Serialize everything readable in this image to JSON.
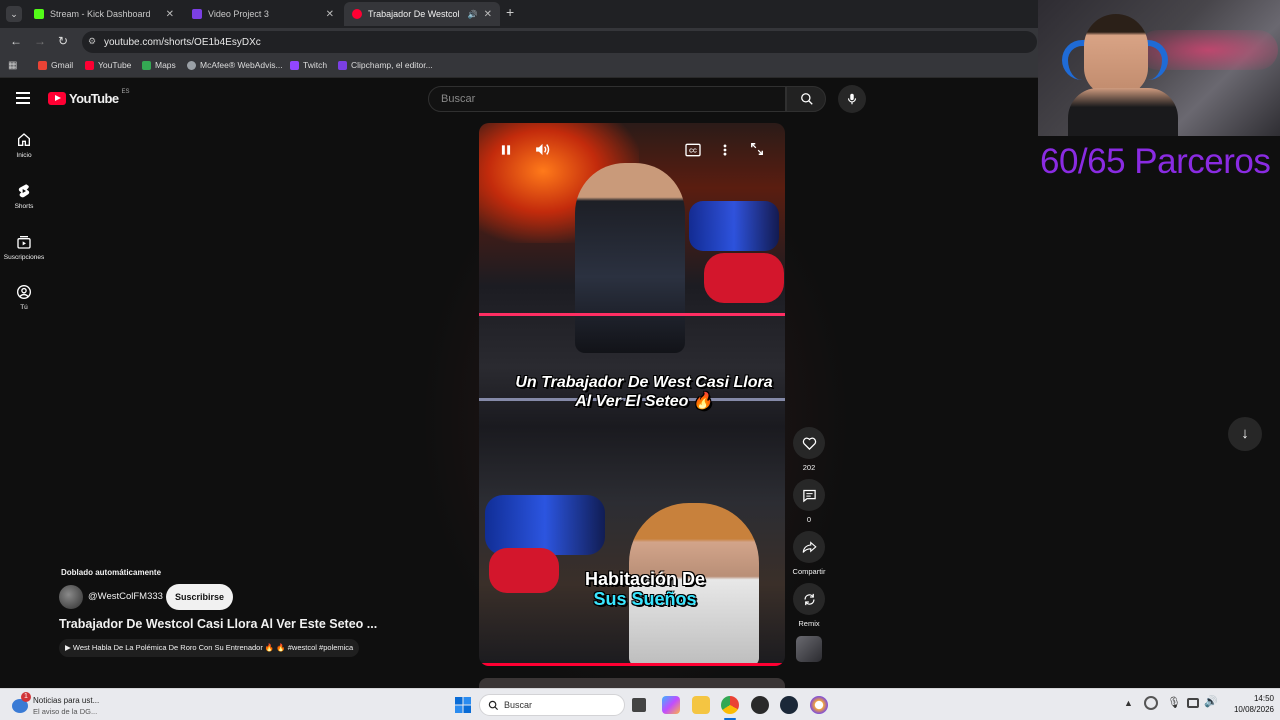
{
  "browser": {
    "tabs": [
      {
        "label": "Stream - Kick Dashboard",
        "color": "#53fc18"
      },
      {
        "label": "Video Project 3",
        "color": "#7b3fe4"
      },
      {
        "label": "Trabajador De Westcol Casi",
        "color": "#ff0033"
      }
    ],
    "new_tab": "+",
    "url": "youtube.com/shorts/OE1b4EsyDXc",
    "bookmarks": [
      "Gmail",
      "YouTube",
      "Maps",
      "McAfee® WebAdvis...",
      "Twitch",
      "Clipchamp, el editor..."
    ]
  },
  "youtube": {
    "logo": "YouTube",
    "region": "ES",
    "search_placeholder": "Buscar",
    "sidebar": [
      {
        "label": "Inicio",
        "icon": "home-icon"
      },
      {
        "label": "Shorts",
        "icon": "shorts-icon"
      },
      {
        "label": "Suscripciones",
        "icon": "subscriptions-icon"
      },
      {
        "label": "Tú",
        "icon": "you-icon"
      }
    ],
    "video": {
      "caption_top": [
        "Un Trabajador De West Casi Llora",
        "Al Ver El Seteo 🔥"
      ],
      "caption_bottom": [
        "Habitación De",
        "Sus Sueños"
      ],
      "dub_label": "Doblado automáticamente",
      "channel": "@WestColFM333",
      "subscribe": "Suscribirse",
      "title": "Trabajador De Westcol Casi Llora Al Ver Este Seteo ...",
      "related": "West Habla De La Polémica De Roro Con Su Entrenador 🔥 🔥 #westcol #polemica"
    },
    "actions": {
      "likes": "202",
      "comments": "0",
      "share": "Compartir",
      "remix": "Remix"
    }
  },
  "overlay": {
    "counter": "60/65 Parceros"
  },
  "taskbar": {
    "news_title": "Noticias para ust...",
    "news_sub": "El aviso de la DG...",
    "news_badge": "1",
    "search": "Buscar",
    "time": "14:50",
    "date": "10/08/2026"
  }
}
